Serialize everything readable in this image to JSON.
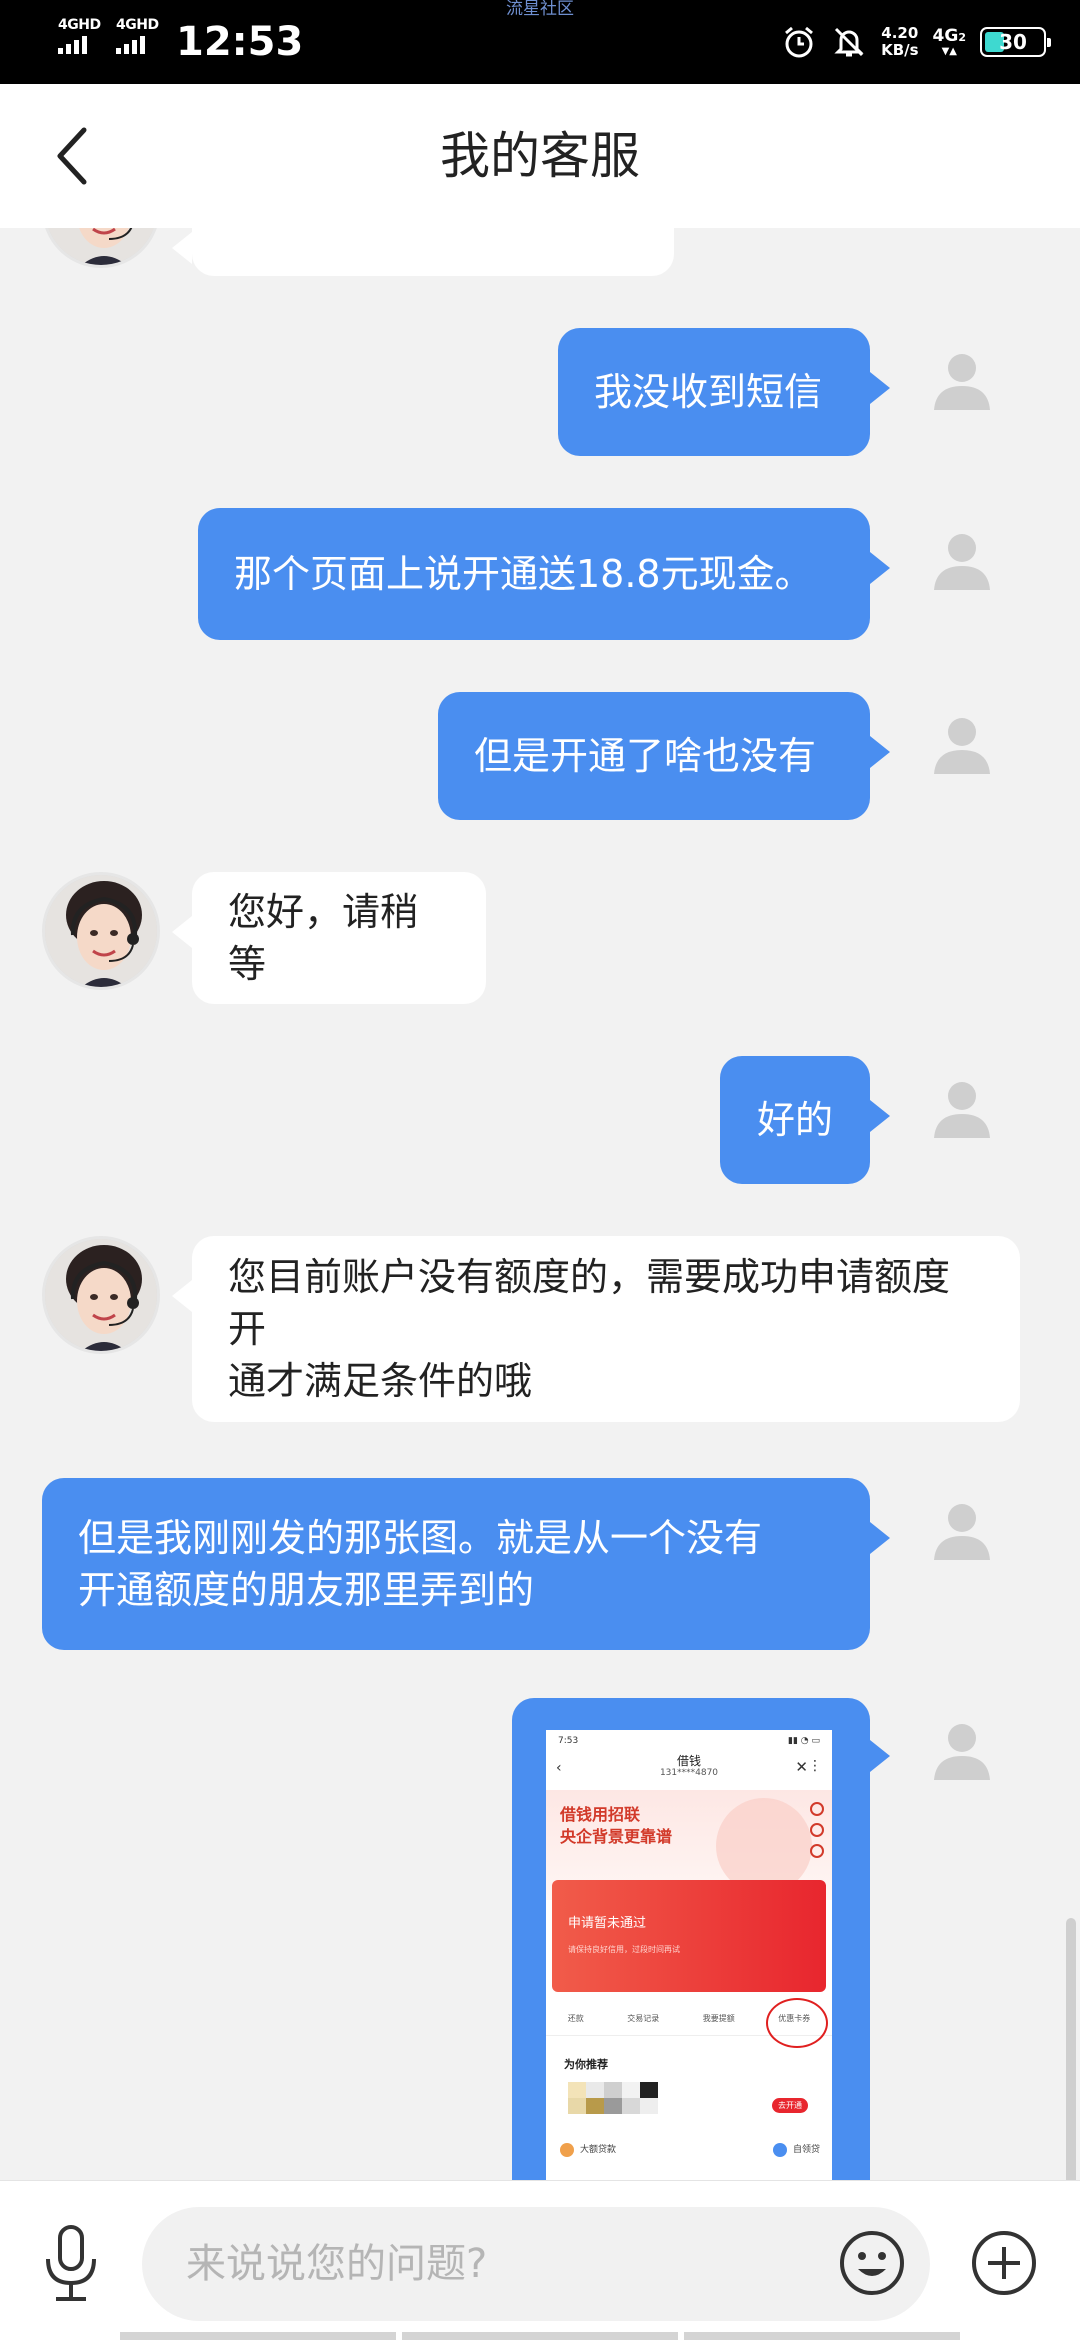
{
  "status_bar": {
    "watermark": "流星社区",
    "signal_1": "4GHD",
    "signal_2": "4GHD",
    "time": "12:53",
    "speed_value": "4.20",
    "speed_unit": "KB/s",
    "network": "4G",
    "network_sub": "2",
    "battery": "30"
  },
  "header": {
    "title": "我的客服"
  },
  "messages": [
    {
      "side": "out",
      "text": "我没收到短信"
    },
    {
      "side": "out",
      "text": "那个页面上说开通送18.8元现金。"
    },
    {
      "side": "out",
      "text": "但是开通了啥也没有"
    },
    {
      "side": "in",
      "text": "您好，请稍等"
    },
    {
      "side": "out",
      "text": "好的"
    },
    {
      "side": "in",
      "text_line1": "您目前账户没有额度的，需要成功申请额度开",
      "text_line2": "通才满足条件的哦"
    },
    {
      "side": "out",
      "text_line1": "但是我刚刚发的那张图。就是从一个没有",
      "text_line2": "开通额度的朋友那里弄到的"
    },
    {
      "side": "out",
      "type": "image"
    }
  ],
  "image_message": {
    "time": "7:53",
    "title": "借钱",
    "phone": "131****4870",
    "slogan_line1": "借钱用招联",
    "slogan_line2": "央企背景更靠谱",
    "card_title": "申请暂未通过",
    "card_sub": "请保持良好信用，过段时间再试",
    "tabs": [
      "还款",
      "交易记录",
      "我要提额",
      "优惠卡券"
    ],
    "recommend": "为你推荐",
    "open_btn": "去开通",
    "bottom_1": "大额贷款",
    "bottom_2": "自领贷"
  },
  "input": {
    "placeholder": "来说说您的问题?"
  },
  "colors": {
    "accent": "#4a8ef0",
    "background": "#f2f2f2"
  }
}
